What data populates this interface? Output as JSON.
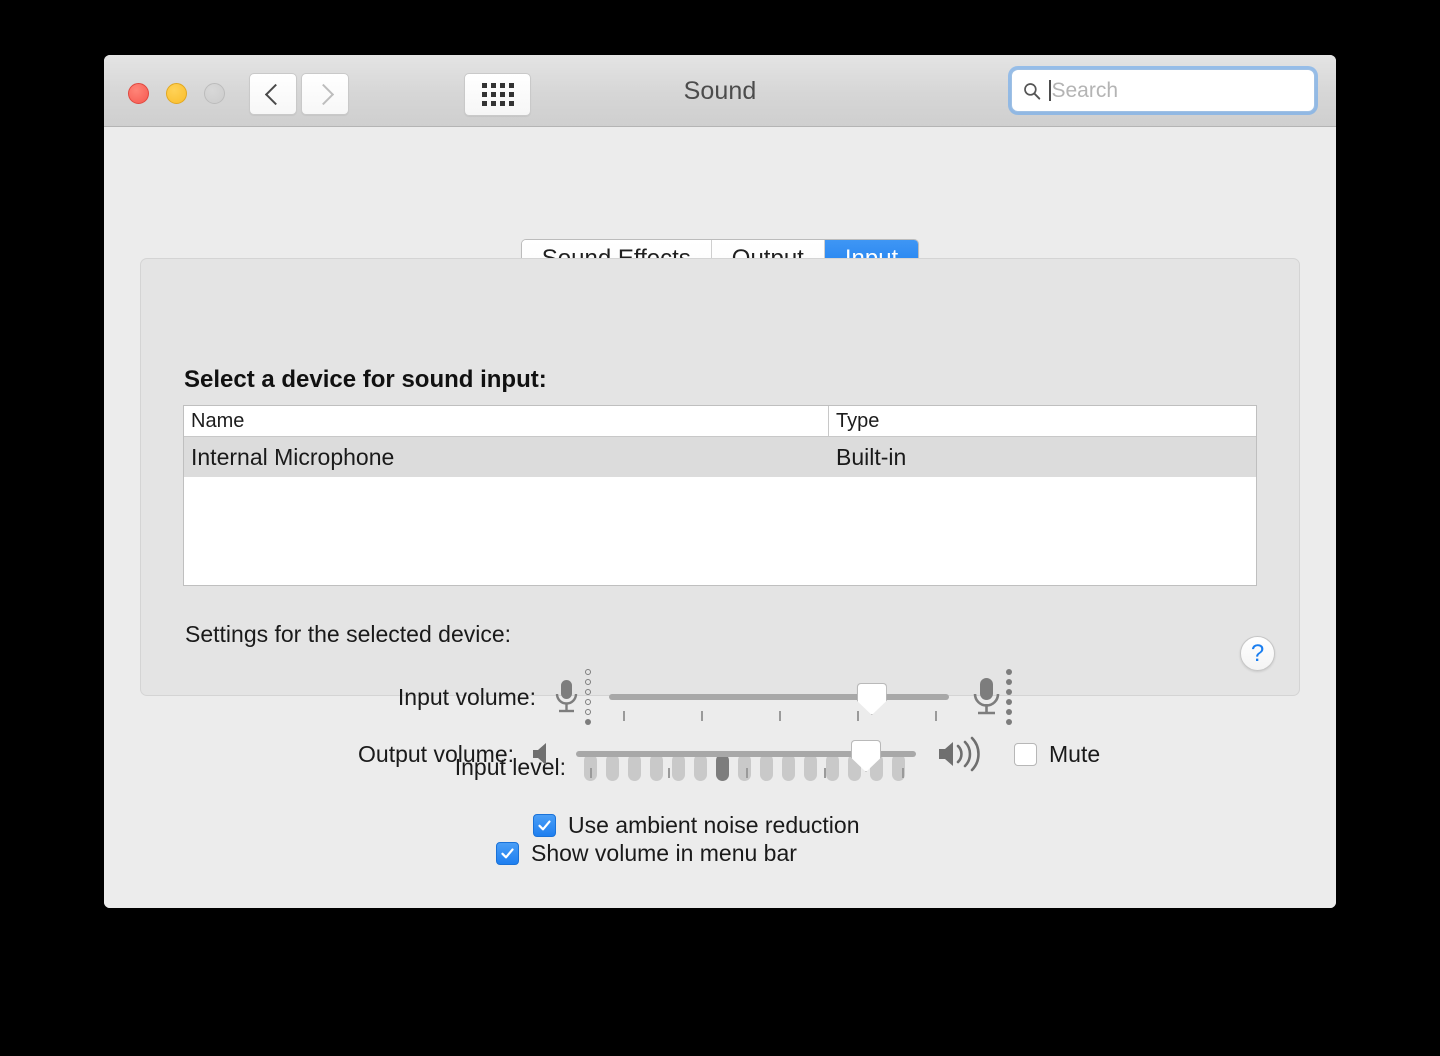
{
  "window": {
    "title": "Sound",
    "traffic_lights": [
      "close",
      "minimize",
      "zoom"
    ],
    "nav": {
      "back": "back-arrow",
      "forward": "forward-arrow",
      "grid": "show-all-grid"
    }
  },
  "search": {
    "placeholder": "Search",
    "value": "",
    "icon": "search-icon",
    "focused": true
  },
  "tabs": [
    {
      "label": "Sound Effects",
      "active": false
    },
    {
      "label": "Output",
      "active": false
    },
    {
      "label": "Input",
      "active": true
    }
  ],
  "input_pane": {
    "heading": "Select a device for sound input:",
    "table": {
      "columns": [
        "Name",
        "Type"
      ],
      "rows": [
        {
          "name": "Internal Microphone",
          "type": "Built-in",
          "selected": true
        }
      ]
    },
    "settings_label": "Settings for the selected device:",
    "input_volume": {
      "label": "Input volume:",
      "value_percent": 77,
      "tick_count": 5,
      "left_icon": "microphone-low-icon",
      "right_icon": "microphone-high-icon"
    },
    "input_level": {
      "label": "Input level:",
      "segments": 15,
      "active_segments": 7
    },
    "ambient_noise": {
      "label": "Use ambient noise reduction",
      "checked": true
    },
    "help_button": "?"
  },
  "footer": {
    "output_volume": {
      "label": "Output volume:",
      "value_percent": 85,
      "tick_count": 5,
      "left_icon": "speaker-mute-icon",
      "right_icon": "speaker-loud-icon"
    },
    "mute": {
      "label": "Mute",
      "checked": false
    },
    "show_volume": {
      "label": "Show volume in menu bar",
      "checked": true
    }
  },
  "colors": {
    "accent_blue": "#1a7ef0",
    "window_bg": "#ececec",
    "panel_bg": "#e4e4e4",
    "selected_row": "#dcdcdc"
  }
}
